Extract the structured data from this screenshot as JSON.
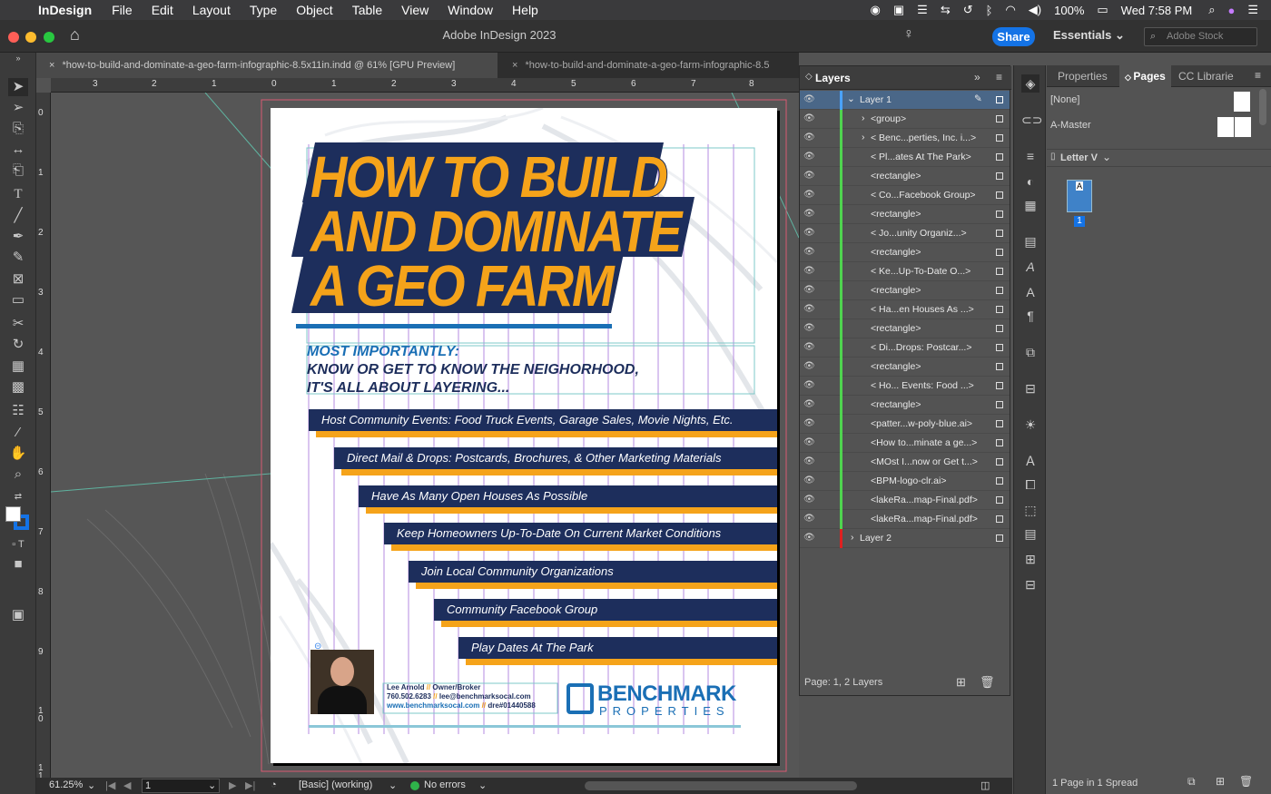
{
  "menubar": {
    "app_name": "InDesign",
    "items": [
      "File",
      "Edit",
      "Layout",
      "Type",
      "Object",
      "Table",
      "View",
      "Window",
      "Help"
    ],
    "battery": "100%",
    "clock": "Wed 7:58 PM"
  },
  "appbar": {
    "title": "Adobe InDesign 2023",
    "share_label": "Share",
    "workspace_label": "Essentials",
    "stock_placeholder": "Adobe Stock"
  },
  "tabs": [
    {
      "label": "*how-to-build-and-dominate-a-geo-farm-infographic-8.5x11in.indd @ 61% [GPU Preview]"
    },
    {
      "label": "*how-to-build-and-dominate-a-geo-farm-infographic-8.5"
    }
  ],
  "ruler": {
    "h_ticks": [
      "3",
      "2",
      "1",
      "0",
      "1",
      "2",
      "3",
      "4",
      "5",
      "6",
      "7",
      "8"
    ],
    "v_ticks": [
      "0",
      "1",
      "2",
      "3",
      "4",
      "5",
      "6",
      "7",
      "8",
      "9",
      "1\n0",
      "1\n1"
    ]
  },
  "document": {
    "title_lines": [
      "HOW TO BUILD",
      "AND DOMINATE",
      "A GEO FARM"
    ],
    "subtitle_1": "MOST IMPORTANTLY:",
    "subtitle_2": "KNOW OR GET TO KNOW THE NEIGHORHOOD,",
    "subtitle_3": "IT'S ALL ABOUT LAYERING...",
    "bars": [
      "Host Community Events: Food Truck Events, Garage Sales, Movie Nights, Etc.",
      "Direct Mail & Drops: Postcards, Brochures, & Other Marketing Materials",
      "Have As Many Open Houses As Possible",
      "Keep Homeowners Up-To-Date On Current Market Conditions",
      "Join Local Community Organizations",
      "Community Facebook Group",
      "Play Dates At The Park"
    ],
    "contact": {
      "name": "Lee Arnold",
      "sep": "//",
      "role": "Owner/Broker",
      "phone": "760.502.6283",
      "email": "lee@benchmarksocal.com",
      "web": "www.benchmarksocal.com",
      "dre": "dre#01440588"
    },
    "logo": {
      "line1": "BENCHMARK",
      "line2": "PROPERTIES"
    }
  },
  "layers": {
    "title": "Layers",
    "rows": [
      {
        "name": "Layer 1",
        "type": "layer",
        "color": "#4aa2ff"
      },
      {
        "name": "<group>",
        "type": "group",
        "color": "#4fd44f"
      },
      {
        "name": "< Benc...perties, Inc. i...>",
        "type": "group",
        "color": "#4fd44f"
      },
      {
        "name": "< Pl...ates At The Park>",
        "type": "item",
        "color": "#4fd44f"
      },
      {
        "name": "<rectangle>",
        "type": "item",
        "color": "#4fd44f"
      },
      {
        "name": "< Co...Facebook Group>",
        "type": "item",
        "color": "#4fd44f"
      },
      {
        "name": "<rectangle>",
        "type": "item",
        "color": "#4fd44f"
      },
      {
        "name": "< Jo...unity Organiz...>",
        "type": "item",
        "color": "#4fd44f"
      },
      {
        "name": "<rectangle>",
        "type": "item",
        "color": "#4fd44f"
      },
      {
        "name": "< Ke...Up-To-Date O...>",
        "type": "item",
        "color": "#4fd44f"
      },
      {
        "name": "<rectangle>",
        "type": "item",
        "color": "#4fd44f"
      },
      {
        "name": "< Ha...en Houses As ...>",
        "type": "item",
        "color": "#4fd44f"
      },
      {
        "name": "<rectangle>",
        "type": "item",
        "color": "#4fd44f"
      },
      {
        "name": "< Di...Drops: Postcar...>",
        "type": "item",
        "color": "#4fd44f"
      },
      {
        "name": "<rectangle>",
        "type": "item",
        "color": "#4fd44f"
      },
      {
        "name": "< Ho... Events: Food ...>",
        "type": "item",
        "color": "#4fd44f"
      },
      {
        "name": "<rectangle>",
        "type": "item",
        "color": "#4fd44f"
      },
      {
        "name": "<patter...w-poly-blue.ai>",
        "type": "item",
        "color": "#4fd44f"
      },
      {
        "name": "<How to...minate a ge...>",
        "type": "item",
        "color": "#4fd44f"
      },
      {
        "name": "<MOst I...now or Get t...>",
        "type": "item",
        "color": "#4fd44f"
      },
      {
        "name": "<BPM-logo-clr.ai>",
        "type": "item",
        "color": "#4fd44f"
      },
      {
        "name": "<lakeRa...map-Final.pdf>",
        "type": "item",
        "color": "#4fd44f"
      },
      {
        "name": "<lakeRa...map-Final.pdf>",
        "type": "item",
        "color": "#4fd44f"
      },
      {
        "name": "Layer 2",
        "type": "layer2",
        "color": "#e02020"
      }
    ],
    "footer": "Page: 1, 2 Layers"
  },
  "pages": {
    "tabs": [
      "Properties",
      "Pages",
      "CC Librarie"
    ],
    "none_label": "[None]",
    "master_label": "A-Master",
    "size_label": "Letter V",
    "page_letter": "A",
    "page_number": "1",
    "footer": "1 Page in 1 Spread"
  },
  "status": {
    "zoom": "61.25%",
    "page": "1",
    "preflight_profile": "[Basic] (working)",
    "errors": "No errors"
  }
}
